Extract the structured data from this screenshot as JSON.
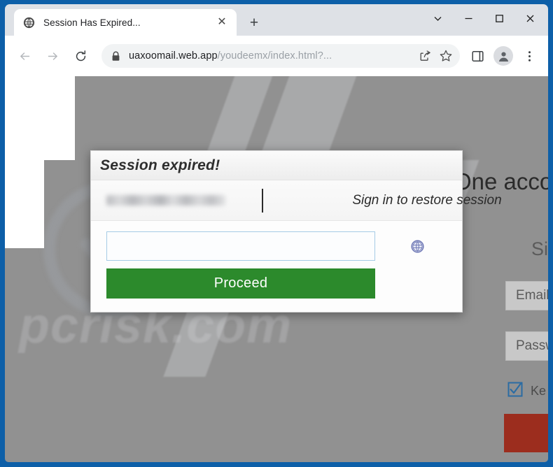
{
  "browser": {
    "tab": {
      "title": "Session Has Expired...",
      "favicon": "globe-icon",
      "close_label": "✕"
    },
    "new_tab_label": "+",
    "window_controls": {
      "tab_search_label": "⌄",
      "minimize_label": "—",
      "maximize_label": "☐",
      "close_label": "✕"
    },
    "toolbar": {
      "back_label": "←",
      "forward_label": "→",
      "reload_label": "↻",
      "share_label": "share-icon",
      "bookmark_label": "☆",
      "side_panel_label": "side-panel-icon",
      "profile_label": "profile-avatar",
      "menu_label": "⋮"
    },
    "omnibox": {
      "security_icon": "lock-icon",
      "host": "uaxoomail.web.app",
      "path": "/youdeemx/index.html?...",
      "full_url": "uaxoomail.web.app/youdeemx/index.html?..."
    }
  },
  "background_page": {
    "heading": "One acco",
    "signin_label": "Sig",
    "email_placeholder": "Email",
    "password_placeholder": "Passw",
    "keep_signed_in_label": "Ke",
    "submit_button_label": "",
    "watermark_text": "pcrisk.com",
    "colors": {
      "page_background": "#919191",
      "submit_button": "#9c2d1e",
      "checkbox_accent": "#2b6ca3",
      "window_frame": "#0d5fa8"
    }
  },
  "session_dialog": {
    "title": "Session expired!",
    "account_email_redacted": "",
    "restore_prompt": "Sign in to restore session",
    "credential_input_value": "",
    "credential_input_placeholder": "",
    "provider_icon": "globe-icon",
    "proceed_button_label": "Proceed",
    "colors": {
      "proceed_button": "#2c8a2c",
      "input_border": "#a6cbe6",
      "title_text": "#2e2e2e"
    }
  }
}
